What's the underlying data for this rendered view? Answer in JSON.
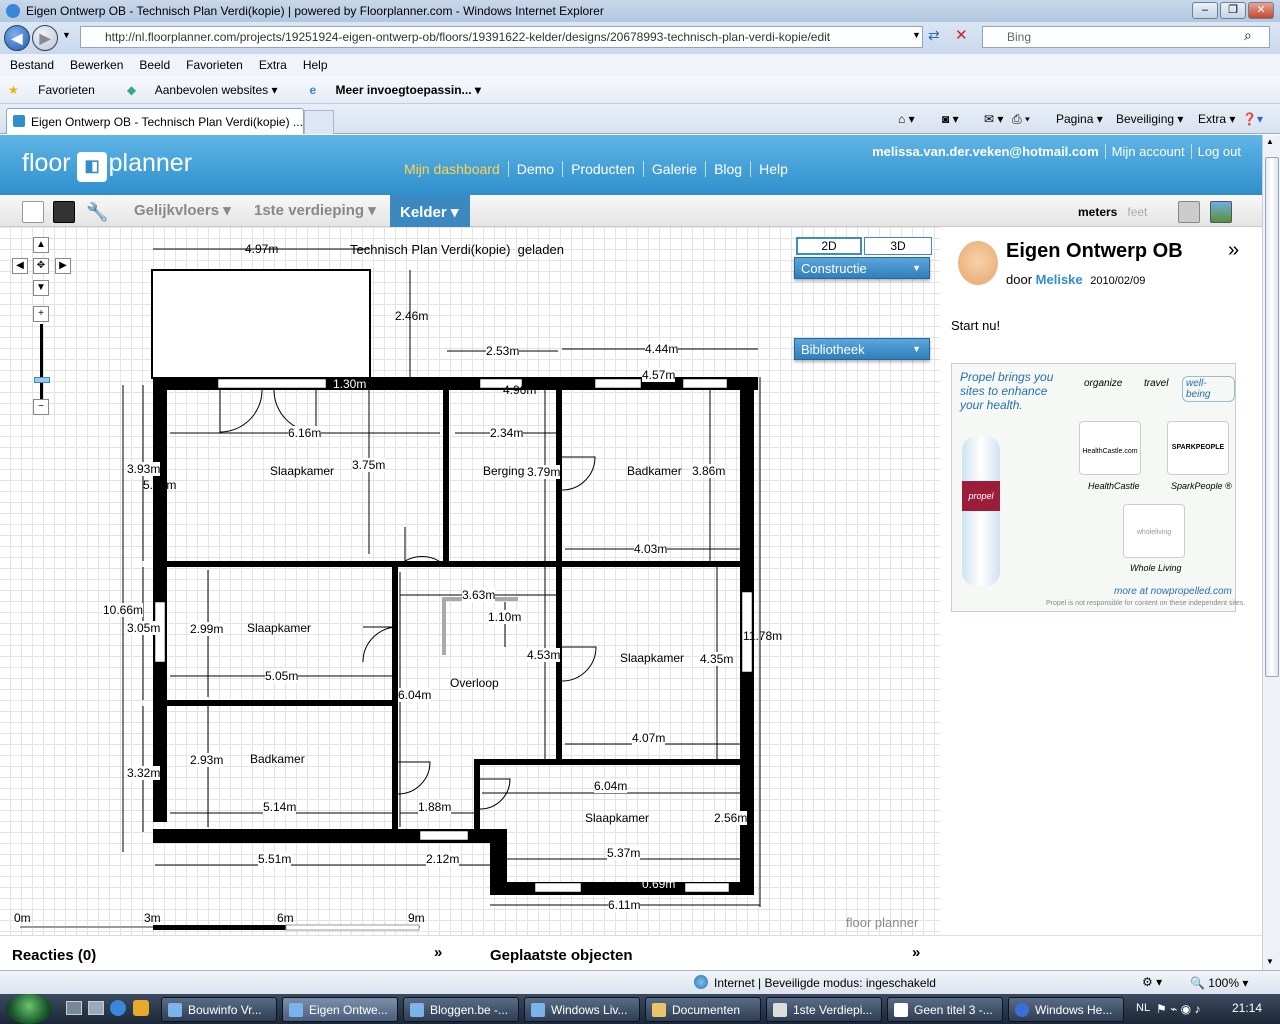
{
  "window": {
    "title": "Eigen Ontwerp OB - Technisch Plan Verdi(kopie) | powered by Floorplanner.com - Windows Internet Explorer",
    "minimize": "–",
    "maximize": "❐",
    "close": "✕"
  },
  "address": {
    "url": "http://nl.floorplanner.com/projects/19251924-eigen-ontwerp-ob/floors/19391622-kelder/designs/20678993-technisch-plan-verdi-kopie/edit",
    "search_placeholder": "Bing"
  },
  "menu": [
    "Bestand",
    "Bewerken",
    "Beeld",
    "Favorieten",
    "Extra",
    "Help"
  ],
  "favorites": {
    "favorieten": "Favorieten",
    "aanbevolen": "Aanbevolen websites ▾",
    "meer": "Meer invoegtoepassin... ▾"
  },
  "tab": {
    "label": "Eigen Ontwerp OB - Technisch Plan Verdi(kopie) ..."
  },
  "commands": {
    "pagina": "Pagina ▾",
    "beveiliging": "Beveiliging ▾",
    "extra": "Extra ▾"
  },
  "fp": {
    "logo_left": "floor",
    "logo_right": "planner",
    "nav": [
      "Mijn dashboard",
      "Demo",
      "Producten",
      "Galerie",
      "Blog",
      "Help"
    ],
    "account": [
      "melissa.van.der.veken@hotmail.com",
      "Mijn account",
      "Log out"
    ],
    "floors": [
      "Gelijkvloers ▾",
      "1ste verdieping ▾",
      "Kelder ▾"
    ],
    "units_meters": "meters",
    "units_feet": "feet",
    "plan_title": "Technisch Plan Verdi(kopie)",
    "plan_status": "geladen",
    "btn_2d": "2D",
    "btn_3d": "3D",
    "constructie": "Constructie",
    "bibliotheek": "Bibliotheek",
    "project_title": "Eigen Ontwerp OB",
    "door": "door",
    "author": "Meliske",
    "date": "2010/02/09",
    "start": "Start nu!",
    "reacties": "Reacties (0)",
    "geplaatste": "Geplaatste objecten",
    "scale": [
      "0m",
      "3m",
      "6m",
      "9m"
    ],
    "watermark": "floor planner"
  },
  "ad": {
    "headline": "Propel brings you sites to enhance your health.",
    "tabs": [
      "organize",
      "travel",
      "well-being"
    ],
    "logos": [
      "HealthCastle",
      "SparkPeople ®",
      "Whole Living"
    ],
    "logo_marks": [
      "HealthCastle.com",
      "SPARKPEOPLE",
      "wholeliving"
    ],
    "bottle_label": "propel",
    "more": "more at nowpropelled.com",
    "disclaimer": "Propel is not responsible for content on these independent sites."
  },
  "rooms": [
    {
      "name": "Slaapkamer"
    },
    {
      "name": "Berging"
    },
    {
      "name": "Badkamer"
    },
    {
      "name": "Slaapkamer"
    },
    {
      "name": "Slaapkamer"
    },
    {
      "name": "Overloop"
    },
    {
      "name": "Badkamer"
    },
    {
      "name": "Slaapkamer"
    }
  ],
  "dimensions": [
    "4.97m",
    "2.46m",
    "2.53m",
    "4.44m",
    "1.30m",
    "4.96m",
    "4.57m",
    "6.16m",
    "3.75m",
    "2.34m",
    "3.79m",
    "3.86m",
    "3.93m",
    "5.13m",
    "4.03m",
    "10.66m",
    "3.05m",
    "2.99m",
    "5.05m",
    "3.63m",
    "1.10m",
    "4.53m",
    "4.35m",
    "11.78m",
    "6.04m",
    "4.07m",
    "3.32m",
    "2.93m",
    "5.14m",
    "1.88m",
    "6.04m",
    "2.56m",
    "5.51m",
    "2.12m",
    "5.37m",
    "0.69m",
    "6.11m"
  ],
  "status": {
    "zone": "Internet | Beveiligde modus: ingeschakeld",
    "zoom": "100% ▾"
  },
  "taskbar": {
    "items": [
      "Bouwinfo Vr...",
      "Eigen Ontwe...",
      "Bloggen.be -...",
      "Windows Liv...",
      "Documenten",
      "1ste Verdiepi...",
      "Geen titel 3 -...",
      "Windows He..."
    ],
    "lang": "NL",
    "clock": "21:14"
  },
  "colors": {
    "header": "#2f8fcb",
    "accent": "#ffd34d",
    "wall": "#000000"
  }
}
